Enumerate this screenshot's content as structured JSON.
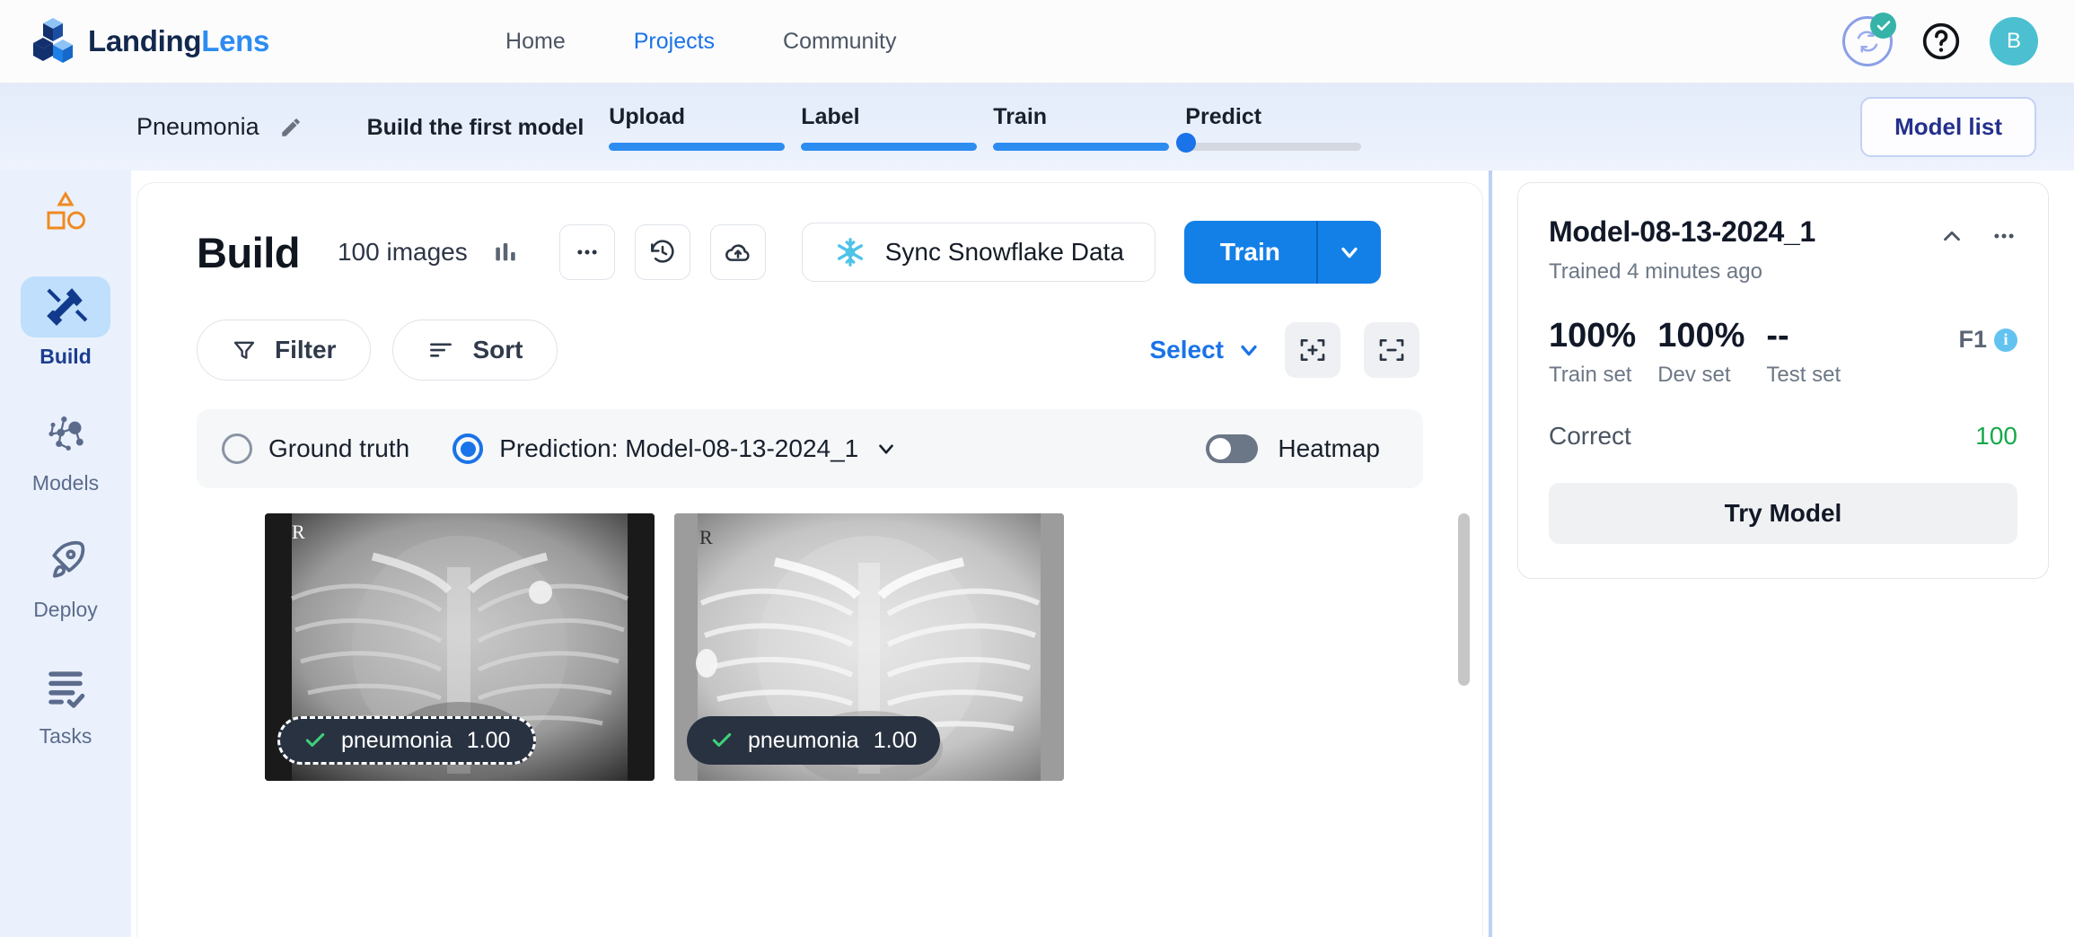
{
  "topnav": {
    "brand": {
      "part1": "Landing",
      "part2": "Lens",
      "icon": "landinglens-logo-icon"
    },
    "links": [
      {
        "label": "Home",
        "active": false
      },
      {
        "label": "Projects",
        "active": true
      },
      {
        "label": "Community",
        "active": false
      }
    ],
    "sync_icon": "sync-status-icon",
    "help_icon": "help-circle-icon",
    "avatar_initial": "B"
  },
  "projectbar": {
    "project_name": "Pneumonia",
    "edit_icon": "pencil-icon",
    "stepper_title": "Build the first model",
    "steps": [
      {
        "label": "Upload",
        "complete": true
      },
      {
        "label": "Label",
        "complete": true
      },
      {
        "label": "Train",
        "complete": true
      },
      {
        "label": "Predict",
        "complete": false
      }
    ],
    "model_list_label": "Model list"
  },
  "rail": {
    "project_icon": "shapes-project-icon",
    "items": [
      {
        "label": "Build",
        "icon": "tools-hammer-icon",
        "active": true
      },
      {
        "label": "Models",
        "icon": "network-nodes-icon",
        "active": false
      },
      {
        "label": "Deploy",
        "icon": "rocket-icon",
        "active": false
      },
      {
        "label": "Tasks",
        "icon": "checklist-icon",
        "active": false
      }
    ]
  },
  "main": {
    "title": "Build",
    "image_count": "100 images",
    "stats_icon": "bar-chart-icon",
    "more_icon": "more-horizontal-icon",
    "history_icon": "history-clock-icon",
    "upload_icon": "cloud-upload-icon",
    "snowflake": {
      "label": "Sync Snowflake Data",
      "icon": "snowflake-icon"
    },
    "train": {
      "label": "Train",
      "caret_icon": "chevron-down-icon"
    },
    "filter": {
      "label": "Filter",
      "icon": "filter-funnel-icon"
    },
    "sort": {
      "label": "Sort",
      "icon": "sort-lines-icon"
    },
    "select": {
      "label": "Select",
      "caret_icon": "chevron-down-icon"
    },
    "zoom_in_icon": "expand-select-plus-icon",
    "zoom_out_icon": "expand-select-minus-icon",
    "modes": {
      "ground_truth": {
        "label": "Ground truth",
        "selected": false
      },
      "prediction": {
        "label": "Prediction: Model-08-13-2024_1",
        "selected": true,
        "caret_icon": "chevron-down-icon"
      }
    },
    "heatmap": {
      "label": "Heatmap",
      "on": false
    },
    "cards": [
      {
        "marker": "R",
        "tag_label": "pneumonia",
        "tag_score": "1.00",
        "check_icon": "check-icon",
        "selected": true
      },
      {
        "marker": "R",
        "tag_label": "pneumonia",
        "tag_score": "1.00",
        "check_icon": "check-icon",
        "selected": false
      }
    ]
  },
  "model_panel": {
    "title": "Model-08-13-2024_1",
    "subtitle": "Trained 4 minutes ago",
    "collapse_icon": "chevron-up-icon",
    "more_icon": "more-horizontal-icon",
    "metrics": [
      {
        "value": "100%",
        "label": "Train set"
      },
      {
        "value": "100%",
        "label": "Dev set"
      },
      {
        "value": "--",
        "label": "Test set"
      }
    ],
    "metric_type": "F1",
    "info_icon": "info-icon",
    "correct_label": "Correct",
    "correct_value": "100",
    "try_model_label": "Try Model"
  },
  "colors": {
    "accent_blue": "#1a73e8",
    "brand_blue": "#2d8cf0",
    "teal": "#4cc0d0",
    "green": "#17a84a",
    "rail_bg": "#eaf1fc"
  }
}
